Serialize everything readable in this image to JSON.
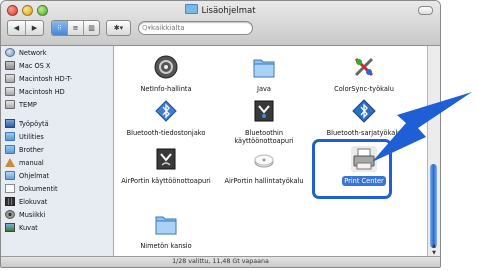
{
  "window": {
    "title": "Lisäohjelmat"
  },
  "toolbar": {
    "back": "◀",
    "forward": "▶",
    "view_icon": "⁝⁝",
    "view_list": "≡",
    "view_column": "▥",
    "action": "✱▾",
    "search_prefix": "Q▾",
    "search_placeholder": "kaikkialta"
  },
  "sidebar": {
    "devices": [
      {
        "label": "Network",
        "icon": "network-icon"
      },
      {
        "label": "Mac OS X",
        "icon": "disk-icon"
      },
      {
        "label": "Macintosh HD-T-",
        "icon": "disk-icon"
      },
      {
        "label": "Macintosh HD",
        "icon": "disk-icon"
      },
      {
        "label": "TEMP",
        "icon": "disk-icon"
      }
    ],
    "places": [
      {
        "label": "Työpöytä",
        "icon": "desktop-icon"
      },
      {
        "label": "Utilities",
        "icon": "folder-icon"
      },
      {
        "label": "Brother",
        "icon": "folder-icon"
      },
      {
        "label": "manual",
        "icon": "home-icon"
      },
      {
        "label": "Ohjelmat",
        "icon": "applications-icon"
      },
      {
        "label": "Dokumentit",
        "icon": "documents-icon"
      },
      {
        "label": "Elokuvat",
        "icon": "movies-icon"
      },
      {
        "label": "Musiikki",
        "icon": "music-icon"
      },
      {
        "label": "Kuvat",
        "icon": "pictures-icon"
      }
    ]
  },
  "items": [
    {
      "label": "NetInfo-hallinta",
      "icon": "netinfo-icon"
    },
    {
      "label": "Java",
      "icon": "folder-icon"
    },
    {
      "label": "ColorSync-työkalu",
      "icon": "colorsync-icon"
    },
    {
      "label": "Bluetooth-tiedostonjako",
      "icon": "bluetooth-icon"
    },
    {
      "label": "Bluetoothin käyttöönottoapuri",
      "icon": "bluetooth-setup-icon"
    },
    {
      "label": "Bluetooth-sarjatyökalu",
      "icon": "bluetooth-icon"
    },
    {
      "label": "AirPortin käyttöönottoapuri",
      "icon": "airport-setup-icon"
    },
    {
      "label": "AirPortin hallintatyökalu",
      "icon": "airport-icon"
    },
    {
      "label": "Print Center",
      "icon": "printer-icon",
      "selected": true
    },
    {
      "label": "Nimetön kansio",
      "icon": "folder-icon"
    }
  ],
  "status": {
    "text": "1/28 valittu, 11,48 Gt vapaana"
  },
  "colors": {
    "selection": "#3875d7",
    "callout": "#1e5fd6",
    "sidebar": "#e7ecf3"
  }
}
